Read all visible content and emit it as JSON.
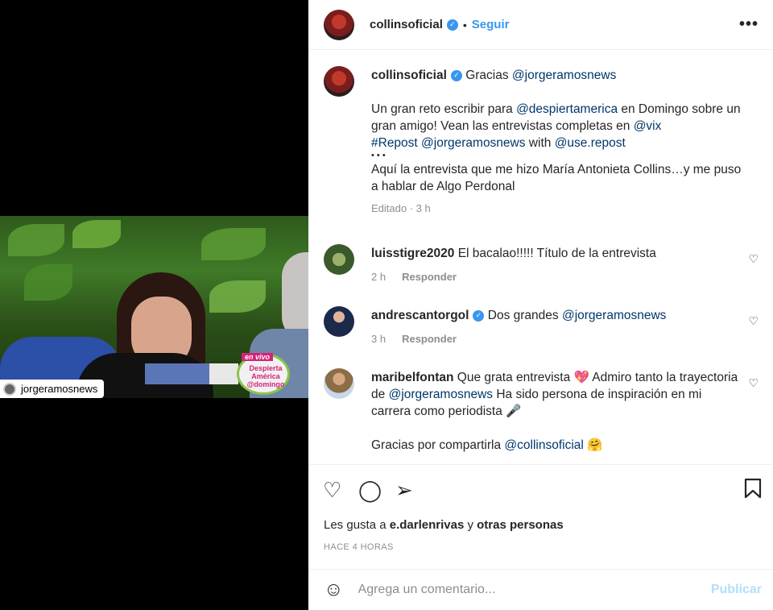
{
  "media": {
    "tag_username": "jorgeramosnews",
    "badge_top": "en vivo",
    "badge_title": "Despierta América @domingo"
  },
  "header": {
    "username": "collinsoficial",
    "separator": "•",
    "follow_label": "Seguir",
    "more_label": "•••"
  },
  "caption": {
    "username": "collinsoficial",
    "line1": "Gracias ",
    "line1_mention": "@jorgeramosnews",
    "p1_a": "Un gran reto escribir para ",
    "p1_m1": "@despiertamerica",
    "p1_b": " en Domingo sobre un gran amigo! Vean las entrevistas completas en ",
    "p1_m2": "@vix",
    "p2_m1": "#Repost",
    "p2_sp": " ",
    "p2_m2": "@jorgeramosnews",
    "p2_b": " with ",
    "p2_m3": "@use.repost",
    "dots": "• • •",
    "p3": "Aquí la entrevista que me hizo María Antonieta Collins…y me puso a hablar de Algo Perdonal",
    "meta": "Editado · 3 h"
  },
  "comments": [
    {
      "username": "luisstigre2020",
      "text": "El bacalao!!!!! Título de la entrevista",
      "time": "2 h",
      "reply": "Responder"
    },
    {
      "username": "andrescantorgol",
      "text": "Dos grandes ",
      "mention": "@jorgeramosnews",
      "time": "3 h",
      "reply": "Responder"
    },
    {
      "username": "maribelfontan",
      "text_a": "Que grata entrevista 💖 Admiro tanto la trayectoria de ",
      "mention": "@jorgeramosnews",
      "text_b": " Ha sido persona de inspiración en mi carrera como periodista 🎤",
      "text_c": "Gracias por compartirla ",
      "mention2": "@collinsoficial",
      "text_d": " 🤗"
    }
  ],
  "actions": {
    "likes_prefix": "Les gusta a ",
    "likes_user": "e.darlenrivas",
    "likes_mid": " y ",
    "likes_others": "otras personas",
    "time_label": "HACE 4 HORAS"
  },
  "add_comment": {
    "placeholder": "Agrega un comentario...",
    "publish_label": "Publicar"
  },
  "icons": {
    "like": "heart-icon",
    "comment": "comment-icon",
    "share": "send-icon",
    "save": "bookmark-icon",
    "emoji": "smile-icon"
  },
  "colors": {
    "accent": "#3897f0",
    "mention": "#00376b",
    "muted": "#8e8e8e",
    "publish_disabled": "#b2dffc"
  }
}
